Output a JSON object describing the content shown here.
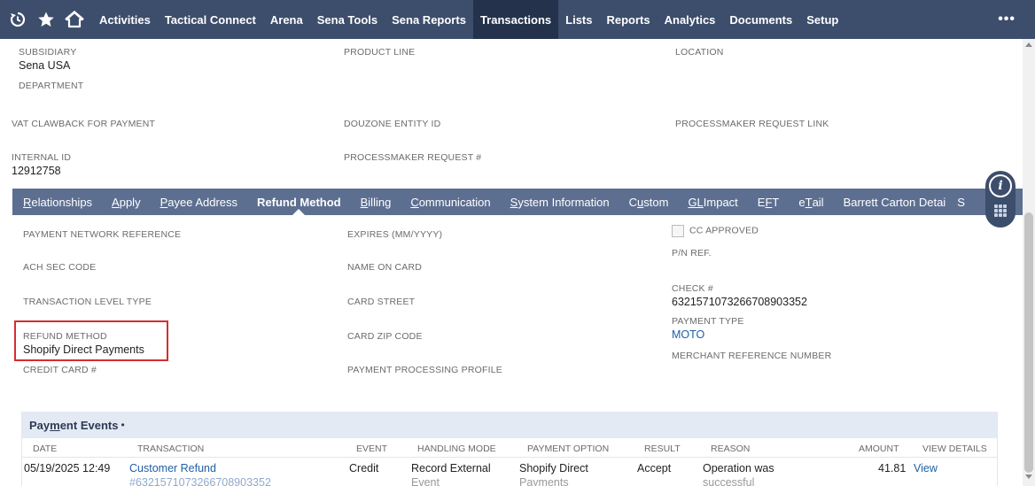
{
  "nav": {
    "icons": [
      "recent-records-icon",
      "star-icon",
      "home-icon"
    ],
    "items": [
      {
        "label": "Activities",
        "active": false
      },
      {
        "label": "Tactical Connect",
        "active": false
      },
      {
        "label": "Arena",
        "active": false
      },
      {
        "label": "Sena Tools",
        "active": false
      },
      {
        "label": "Sena Reports",
        "active": false
      },
      {
        "label": "Transactions",
        "active": true
      },
      {
        "label": "Lists",
        "active": false
      },
      {
        "label": "Reports",
        "active": false
      },
      {
        "label": "Analytics",
        "active": false
      },
      {
        "label": "Documents",
        "active": false
      },
      {
        "label": "Setup",
        "active": false
      }
    ],
    "more_label": "•••",
    "colors": {
      "bar": "#3d4d6c",
      "active": "#24324c"
    }
  },
  "main_fields": {
    "subsidiary": {
      "label": "SUBSIDIARY",
      "value": "Sena USA"
    },
    "product_line": {
      "label": "PRODUCT LINE",
      "value": ""
    },
    "location": {
      "label": "LOCATION",
      "value": ""
    },
    "department": {
      "label": "DEPARTMENT",
      "value": ""
    },
    "vat_clawback": {
      "label": "VAT CLAWBACK FOR PAYMENT",
      "value": ""
    },
    "douzone_entity": {
      "label": "DOUZONE ENTITY ID",
      "value": ""
    },
    "processmaker_link": {
      "label": "PROCESSMAKER REQUEST LINK",
      "value": ""
    },
    "internal_id": {
      "label": "INTERNAL ID",
      "value": "12912758"
    },
    "processmaker_request": {
      "label": "PROCESSMAKER REQUEST #",
      "value": ""
    }
  },
  "tabs": {
    "relationships": {
      "first": "R",
      "rest": "elationships"
    },
    "apply": {
      "first": "A",
      "rest": "pply"
    },
    "payee_address": {
      "first": "P",
      "rest": "ayee Address"
    },
    "refund_method": {
      "label": "Refund Method"
    },
    "billing": {
      "first": "B",
      "rest": "illing"
    },
    "communication": {
      "first": "C",
      "rest": "ommunication"
    },
    "system_information": {
      "first": "S",
      "rest": "ystem Information"
    },
    "custom": {
      "pre": "C",
      "u": "u",
      "post": "stom"
    },
    "gl_impact": {
      "first": "GL",
      "rest": " Impact"
    },
    "eft": {
      "pre": "E",
      "u": "F",
      "post": "T"
    },
    "etail": {
      "pre": "e",
      "u": "T",
      "post": "ail"
    },
    "barrett": {
      "label": "Barrett Carton Detai"
    },
    "s_partial": {
      "label": "S"
    }
  },
  "refund_fields": {
    "payment_network_reference": {
      "label": "PAYMENT NETWORK REFERENCE",
      "value": ""
    },
    "expires": {
      "label": "EXPIRES (MM/YYYY)",
      "value": ""
    },
    "cc_approved": {
      "label": "CC APPROVED",
      "checked": false
    },
    "pn_ref": {
      "label": "P/N REF.",
      "value": ""
    },
    "ach_sec_code": {
      "label": "ACH SEC CODE",
      "value": ""
    },
    "name_on_card": {
      "label": "NAME ON CARD",
      "value": ""
    },
    "check_number": {
      "label": "CHECK #",
      "value": "6321571073266708903352"
    },
    "transaction_level_type": {
      "label": "TRANSACTION LEVEL TYPE",
      "value": ""
    },
    "card_street": {
      "label": "CARD STREET",
      "value": ""
    },
    "payment_type": {
      "label": "PAYMENT TYPE",
      "value": "MOTO"
    },
    "refund_method": {
      "label": "REFUND METHOD",
      "value": "Shopify Direct Payments"
    },
    "card_zip_code": {
      "label": "CARD ZIP CODE",
      "value": ""
    },
    "merchant_reference_number": {
      "label": "MERCHANT REFERENCE NUMBER",
      "value": ""
    },
    "credit_card_number": {
      "label": "CREDIT CARD #",
      "value": ""
    },
    "payment_processing_profile": {
      "label": "PAYMENT PROCESSING PROFILE",
      "value": ""
    }
  },
  "payment_events": {
    "title_pre": "Pay",
    "title_u": "m",
    "title_post": "ent Events",
    "dot": "•",
    "columns": {
      "date": "DATE",
      "transaction": "TRANSACTION",
      "event": "EVENT",
      "handling_mode": "HANDLING MODE",
      "payment_option": "PAYMENT OPTION",
      "result": "RESULT",
      "reason": "REASON",
      "amount": "AMOUNT",
      "view_details": "VIEW DETAILS"
    },
    "rows": [
      {
        "date": "05/19/2025 12:49",
        "transaction": "Customer Refund",
        "transaction_sub": "#6321571073266708903352",
        "event": "Credit",
        "handling_mode": "Record External",
        "handling_mode_sub": "Event",
        "payment_option": "Shopify Direct",
        "payment_option_sub": "Payments",
        "result": "Accept",
        "reason": "Operation was",
        "reason_sub": "successful",
        "amount": "41.81",
        "view": "View"
      }
    ]
  },
  "float_widget": {
    "icons": [
      "info-icon",
      "apps-grid-icon"
    ]
  }
}
